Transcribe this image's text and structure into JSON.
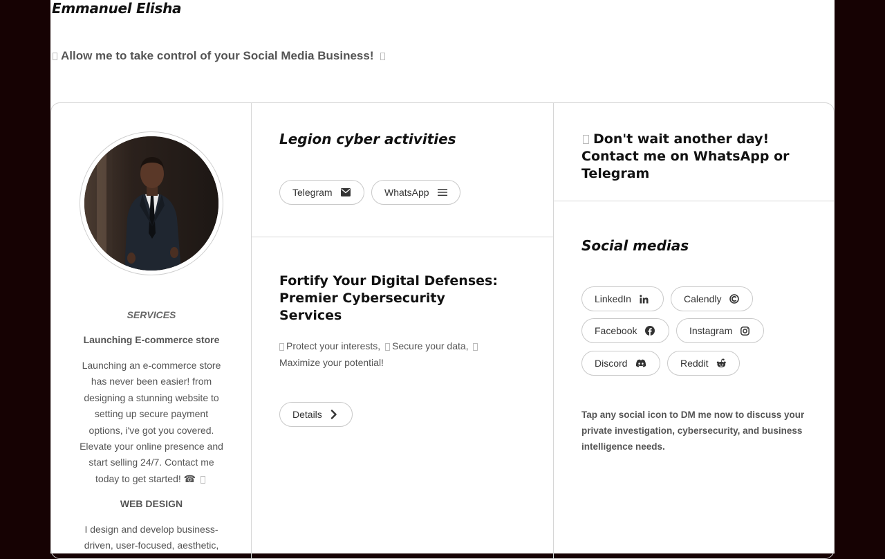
{
  "header": {
    "brand": "Emmanuel Elisha",
    "tagline": "Allow me to take control of your Social Media Business!"
  },
  "sidebar": {
    "avatar_alt": "Portrait of a man in a dark suit",
    "services_title": "SERVICES",
    "service_1_title": "Launching E-commerce store",
    "service_1_body": "Launching an e-commerce store has never been easier! from designing a stunning website to setting up secure payment options, i've got you covered. Elevate your online presence and start selling 24/7. Contact me today to get started! ☎",
    "service_2_title": "WEB DESIGN",
    "service_2_body": "I design and develop business-driven, user-focused, aesthetic,"
  },
  "legion": {
    "title": "Legion cyber activities",
    "buttons": [
      {
        "label": "Telegram",
        "icon": "envelope-icon"
      },
      {
        "label": "WhatsApp",
        "icon": "menu-icon"
      }
    ]
  },
  "fortify": {
    "title": "Fortify Your Digital Defenses: Premier Cybersecurity Services",
    "desc_1": "Protect your interests,",
    "desc_2": "Secure your data,",
    "desc_3": "Maximize your potential!",
    "details_label": "Details"
  },
  "contact": {
    "title": "Don't wait another day! Contact me on WhatsApp or Telegram"
  },
  "social": {
    "title": "Social medias",
    "buttons": [
      {
        "label": "LinkedIn",
        "icon": "linkedin-icon"
      },
      {
        "label": "Calendly",
        "icon": "calendly-icon"
      },
      {
        "label": "Facebook",
        "icon": "facebook-icon"
      },
      {
        "label": "Instagram",
        "icon": "instagram-icon"
      },
      {
        "label": "Discord",
        "icon": "discord-icon"
      },
      {
        "label": "Reddit",
        "icon": "reddit-icon"
      }
    ],
    "note": "Tap any social icon to DM me now to discuss your private investigation, cybersecurity, and business intelligence needs."
  },
  "colors": {
    "page_background": "#160203",
    "card_background": "#ffffff",
    "border": "#d6d6d6",
    "text_dark": "#111111",
    "text_muted": "#555555"
  }
}
